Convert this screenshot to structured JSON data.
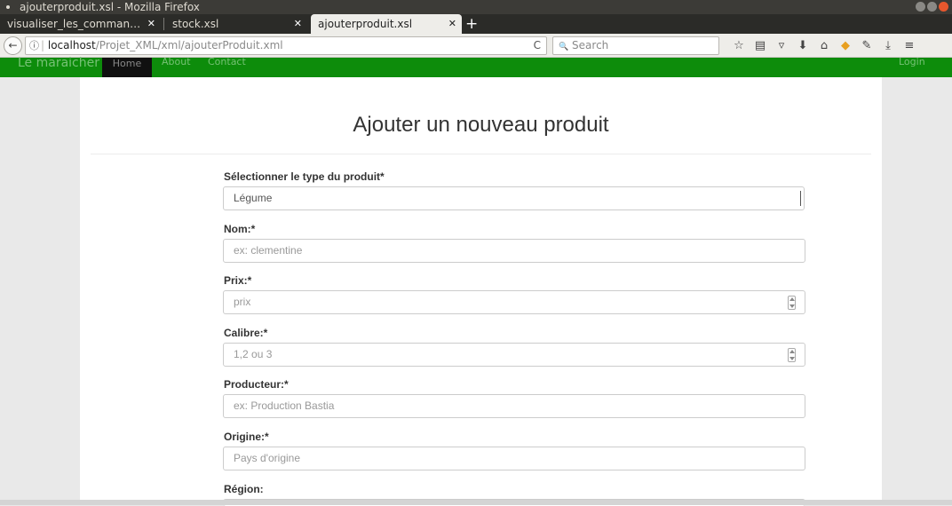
{
  "window": {
    "title": "ajouterproduit.xsl - Mozilla Firefox",
    "tabs": [
      {
        "label": "visualiser_les_comman…"
      },
      {
        "label": "stock.xsl"
      },
      {
        "label": "ajouterproduit.xsl"
      }
    ],
    "new_tab": "+",
    "close_glyph": "✕"
  },
  "navbar": {
    "back": "←",
    "info_icon": "ⓘ",
    "url_host": "localhost",
    "url_path": "/Projet_XML/xml/ajouterProduit.xml",
    "reload": "C",
    "search_placeholder": "Search",
    "search_glyph": "🔍"
  },
  "site": {
    "brand": "Le maraicher",
    "nav": [
      "Home",
      "About",
      "Contact"
    ],
    "login": "Login",
    "brand_color": "#0d8c0b"
  },
  "form": {
    "title": "Ajouter un nouveau produit",
    "type_label": "Sélectionner le type du produit*",
    "type_value": "Légume",
    "nom_label": "Nom:*",
    "nom_placeholder": "ex: clementine",
    "prix_label": "Prix:*",
    "prix_placeholder": "prix",
    "calibre_label": "Calibre:*",
    "calibre_placeholder": "1,2 ou 3",
    "producteur_label": "Producteur:*",
    "producteur_placeholder": "ex: Production Bastia",
    "origine_label": "Origine:*",
    "origine_placeholder": "Pays d'origine",
    "region_label": "Région:"
  }
}
